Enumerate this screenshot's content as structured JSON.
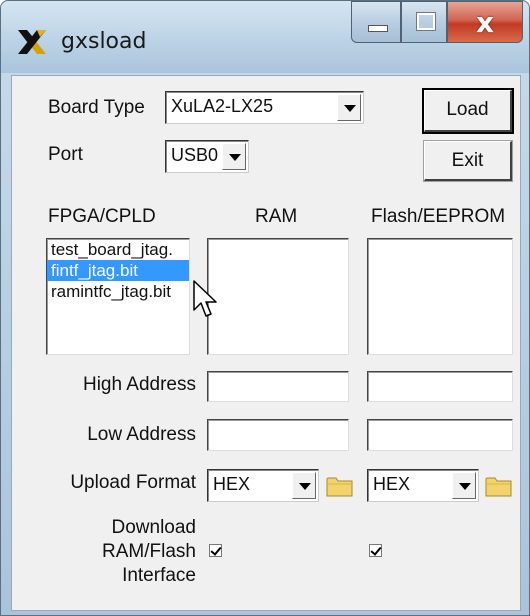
{
  "window": {
    "title": "gxsload",
    "close_glyph": "x"
  },
  "board_type": {
    "label": "Board Type",
    "value": "XuLA2-LX25"
  },
  "port": {
    "label": "Port",
    "value": "USB0"
  },
  "buttons": {
    "load": "Load",
    "exit": "Exit"
  },
  "columns": {
    "fpga": "FPGA/CPLD",
    "ram": "RAM",
    "flash": "Flash/EEPROM"
  },
  "fpga_list": {
    "items": [
      "test_board_jtag.",
      "fintf_jtag.bit",
      "ramintfc_jtag.bit"
    ],
    "selected_index": 1
  },
  "address": {
    "high_label": "High Address",
    "low_label": "Low Address",
    "ram_high": "",
    "ram_low": "",
    "flash_high": "",
    "flash_low": ""
  },
  "upload_format": {
    "label": "Upload Format",
    "ram_value": "HEX",
    "flash_value": "HEX"
  },
  "download_interface": {
    "label_line1": "Download",
    "label_line2": "RAM/Flash",
    "label_line3": "Interface",
    "ram_checked": true,
    "flash_checked": true
  },
  "icons": {
    "app": "xilinx-x-icon",
    "folder": "folder-icon",
    "cursor": "mouse-pointer-icon"
  },
  "colors": {
    "selection": "#3399ff",
    "titlebar": "#bcd3e6",
    "close": "#c23a23"
  }
}
